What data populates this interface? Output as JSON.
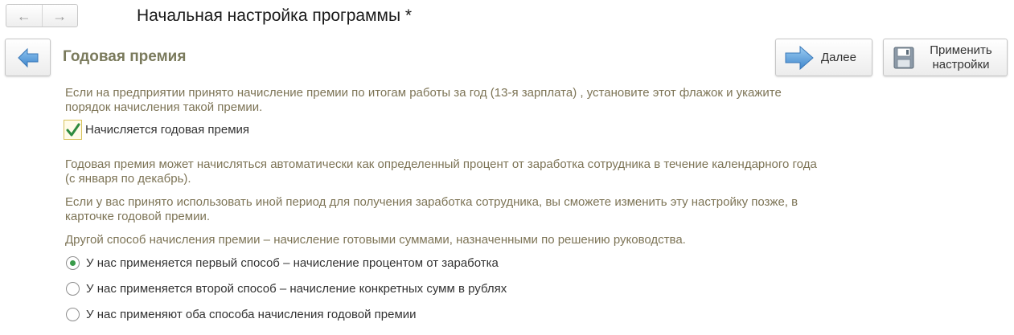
{
  "window": {
    "title": "Начальная настройка программы *"
  },
  "section": {
    "title": "Годовая премия"
  },
  "toolbar": {
    "next_label": "Далее",
    "apply_label_line1": "Применить",
    "apply_label_line2": "настройки"
  },
  "texts": {
    "intro": "Если на предприятии принято начисление премии по итогам работы за год (13-я зарплата) , установите этот флажок и укажите порядок начисления такой премии.",
    "auto_calc": "Годовая премия может начисляться автоматически как определенный процент от заработка сотрудника в течение календарного года (с января по декабрь).",
    "other_period": "Если у вас принято использовать иной период для получения заработка сотрудника, вы сможете изменить эту настройку позже, в карточке годовой премии.",
    "other_method": "Другой способ начисления премии – начисление готовыми суммами, назначенными по решению руководства."
  },
  "checkbox": {
    "label": "Начисляется годовая премия",
    "checked": true
  },
  "radio_options": [
    {
      "label": "У нас применяется первый способ – начисление процентом от заработка",
      "selected": true
    },
    {
      "label": "У нас применяется второй способ – начисление конкретных сумм в рублях",
      "selected": false
    },
    {
      "label": "У нас применяют оба способа начисления годовой премии",
      "selected": false
    }
  ],
  "colors": {
    "accent_green": "#3a9b4a",
    "info_text": "#7d7456",
    "section_title": "#7a7a5c",
    "arrow_blue": "#5b9bd5"
  }
}
